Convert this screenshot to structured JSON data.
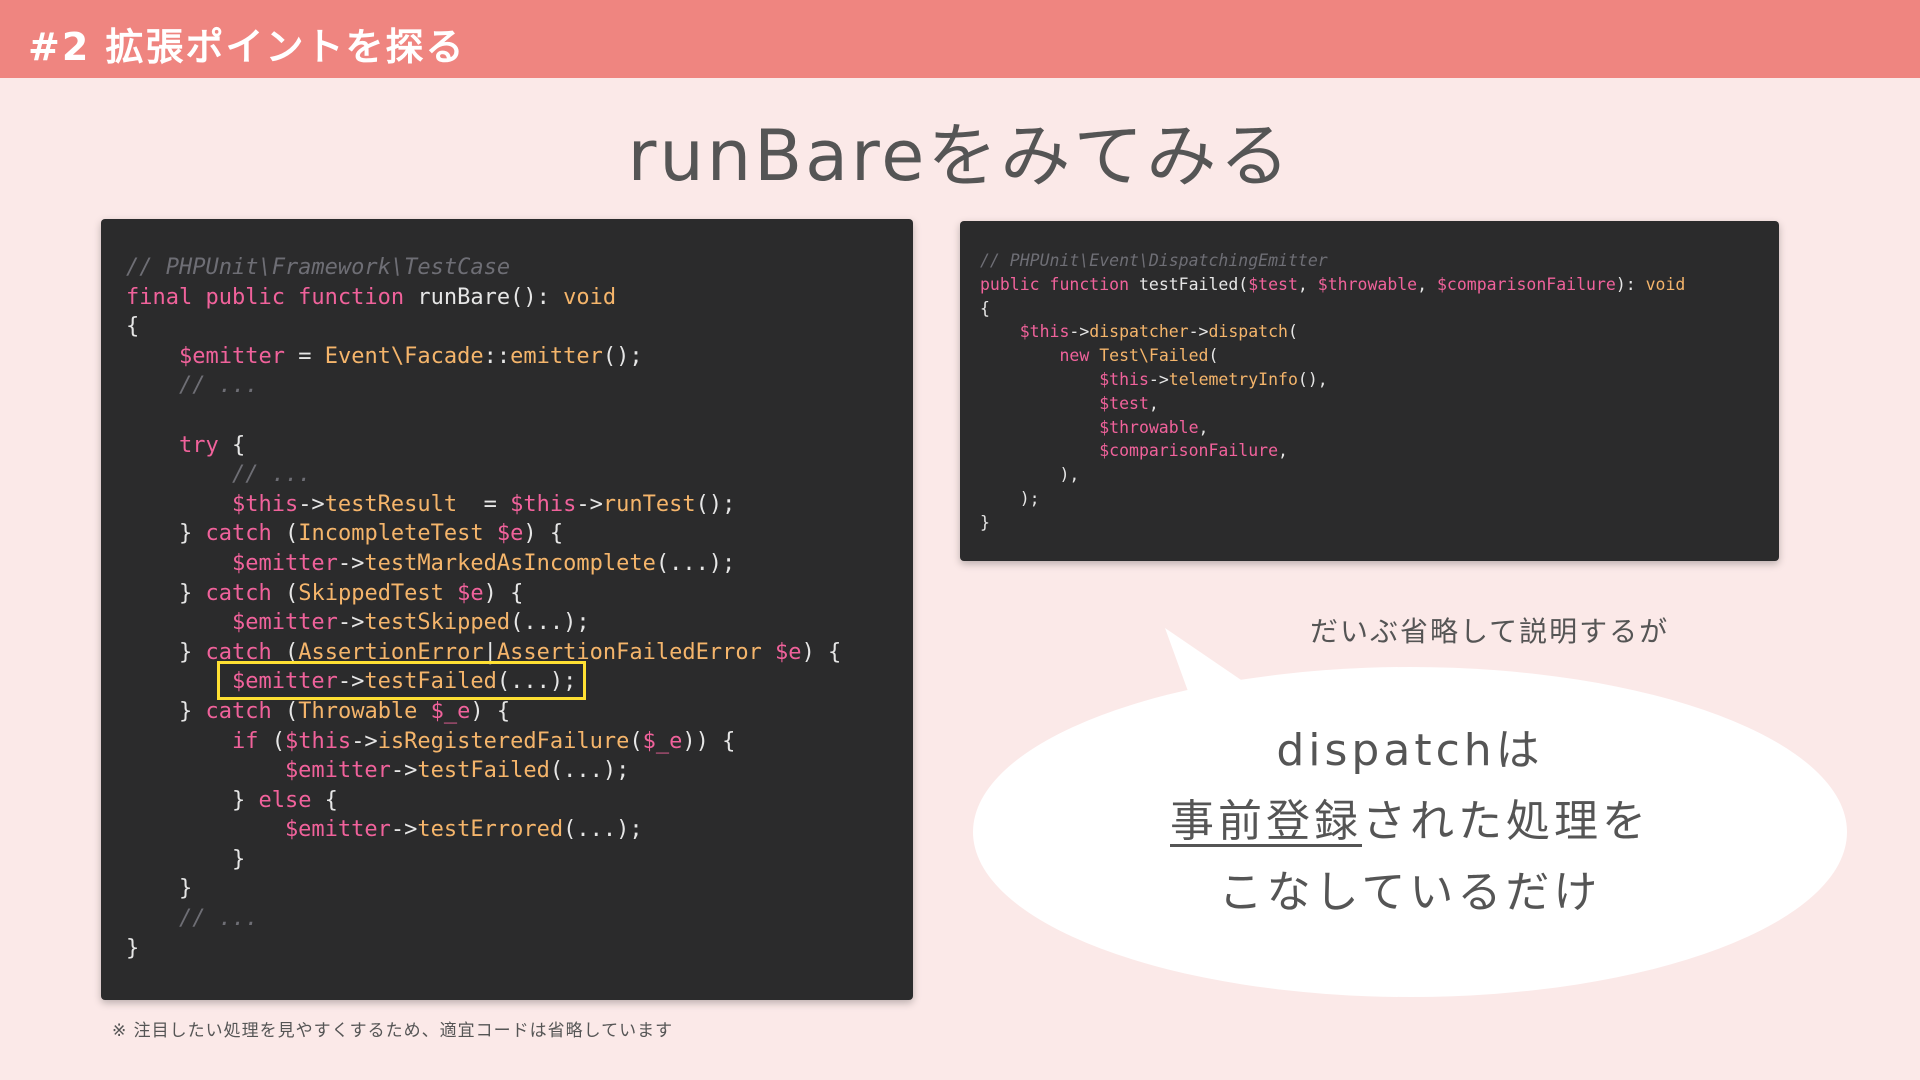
{
  "header": {
    "title": "#2 拡張ポイントを探る"
  },
  "slide": {
    "title": "runBareをみてみる"
  },
  "left_code": {
    "l01": "// PHPUnit\\Framework\\TestCase",
    "l02a": "final public function",
    "l02b": " runBare",
    "l02c": "(): ",
    "l02d": "void",
    "l03": "{",
    "l04a": "    $emitter",
    "l04b": " = ",
    "l04c": "Event\\Facade",
    "l04d": "::",
    "l04e": "emitter",
    "l04f": "();",
    "l05": "    // ...",
    "l06": "",
    "l07a": "    try",
    "l07b": " {",
    "l08": "        // ...",
    "l09a": "        $this",
    "l09b": "->",
    "l09c": "testResult",
    "l09d": "  = ",
    "l09e": "$this",
    "l09f": "->",
    "l09g": "runTest",
    "l09h": "();",
    "l10a": "    } ",
    "l10b": "catch",
    "l10c": " (",
    "l10d": "IncompleteTest",
    "l10e": " $e",
    "l10f": ") {",
    "l11a": "        $emitter",
    "l11b": "->",
    "l11c": "testMarkedAsIncomplete",
    "l11d": "(...);",
    "l12a": "    } ",
    "l12b": "catch",
    "l12c": " (",
    "l12d": "SkippedTest",
    "l12e": " $e",
    "l12f": ") {",
    "l13a": "        $emitter",
    "l13b": "->",
    "l13c": "testSkipped",
    "l13d": "(...);",
    "l14a": "    } ",
    "l14b": "catch",
    "l14c": " (",
    "l14d": "AssertionError",
    "l14e": "|",
    "l14f": "AssertionFailedError",
    "l14g": " $e",
    "l14h": ") {",
    "l15a": "        $emitter",
    "l15b": "->",
    "l15c": "testFailed",
    "l15d": "(...);",
    "l16a": "    } ",
    "l16b": "catch",
    "l16c": " (",
    "l16d": "Throwable",
    "l16e": " $_e",
    "l16f": ") {",
    "l17a": "        if",
    "l17b": " (",
    "l17c": "$this",
    "l17d": "->",
    "l17e": "isRegisteredFailure",
    "l17f": "(",
    "l17g": "$_e",
    "l17h": ")) {",
    "l18a": "            $emitter",
    "l18b": "->",
    "l18c": "testFailed",
    "l18d": "(...);",
    "l19a": "        } ",
    "l19b": "else",
    "l19c": " {",
    "l20a": "            $emitter",
    "l20b": "->",
    "l20c": "testErrored",
    "l20d": "(...);",
    "l21": "        }",
    "l22": "    }",
    "l23": "    // ...",
    "l24": "}"
  },
  "right_code": {
    "l01": "// PHPUnit\\Event\\DispatchingEmitter",
    "l02a": "public function",
    "l02b": " testFailed",
    "l02c": "(",
    "l02d": "$test",
    "l02e": ", ",
    "l02f": "$throwable",
    "l02g": ", ",
    "l02h": "$comparisonFailure",
    "l02i": "): ",
    "l02j": "void",
    "l03": "{",
    "l04a": "    $this",
    "l04b": "->",
    "l04c": "dispatcher",
    "l04d": "->",
    "l04e": "dispatch",
    "l04f": "(",
    "l05a": "        new",
    "l05b": " Test\\Failed",
    "l05c": "(",
    "l06a": "            $this",
    "l06b": "->",
    "l06c": "telemetryInfo",
    "l06d": "(),",
    "l07a": "            $test",
    "l07b": ",",
    "l08a": "            $throwable",
    "l08b": ",",
    "l09a": "            $comparisonFailure",
    "l09b": ",",
    "l10": "        ),",
    "l11": "    );",
    "l12": "}"
  },
  "footnote": "※ 注目したい処理を見やすくするため、適宜コードは省略しています",
  "bubble": {
    "caption": "だいぶ省略して説明するが",
    "line1": "dispatchは",
    "line2_underlined": "事前登録",
    "line2_rest": "された処理を",
    "line3": "こなしているだけ"
  },
  "colors": {
    "header": "#ef8580",
    "background": "#fbe9e8",
    "code_bg": "#2b2b2c",
    "keyword": "#f0629b",
    "function": "#f5b56b",
    "highlight": "#ffe033"
  }
}
